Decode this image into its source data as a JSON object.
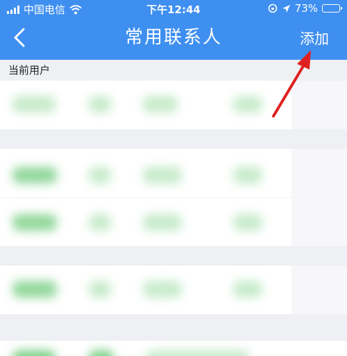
{
  "status_bar": {
    "carrier": "中国电信",
    "time": "下午12:44",
    "battery": "73%",
    "battery_level": 0.73
  },
  "nav": {
    "title": "常用联系人",
    "add_label": "添加"
  },
  "sections": {
    "current_user": "当前用户"
  },
  "colors": {
    "primary": "#3f8ff0",
    "accent_green": "#39b24a",
    "annotation_red": "#e02020"
  }
}
